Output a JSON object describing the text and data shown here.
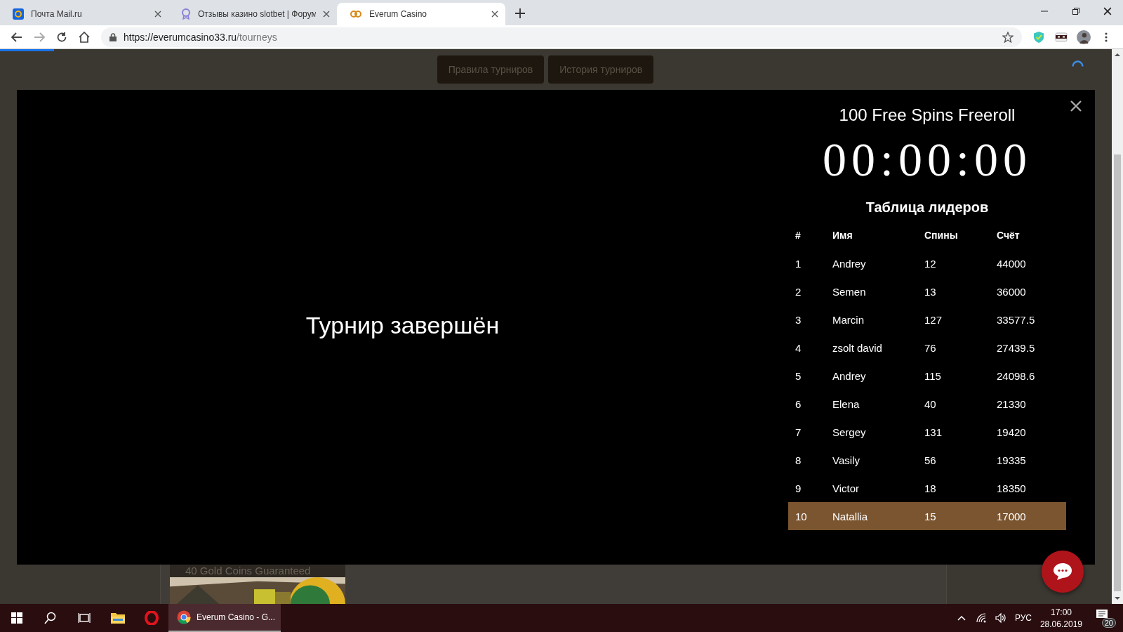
{
  "browser": {
    "tabs": [
      {
        "title": "Почта Mail.ru",
        "kind": "mail",
        "selected": false
      },
      {
        "title": "Отзывы казино slotbet | Форум",
        "kind": "forum",
        "selected": false
      },
      {
        "title": "Everum Casino",
        "kind": "casino",
        "selected": true
      }
    ],
    "url": {
      "host": "https://everumcasino33.ru",
      "path": "/tourneys"
    }
  },
  "page": {
    "buttons": [
      "Правила турниров",
      "История турниров"
    ],
    "modal": {
      "status": "Турнир завершён",
      "title": "100 Free Spins Freeroll",
      "timer": "00:00:00",
      "leaderboard": {
        "heading": "Таблица лидеров",
        "columns": [
          "#",
          "Имя",
          "Спины",
          "Счёт"
        ],
        "rows": [
          {
            "rank": "1",
            "name": "Andrey",
            "spins": "12",
            "score": "44000",
            "highlighted": false
          },
          {
            "rank": "2",
            "name": "Semen",
            "spins": "13",
            "score": "36000",
            "highlighted": false
          },
          {
            "rank": "3",
            "name": "Marcin",
            "spins": "127",
            "score": "33577.5",
            "highlighted": false
          },
          {
            "rank": "4",
            "name": "zsolt david",
            "spins": "76",
            "score": "27439.5",
            "highlighted": false
          },
          {
            "rank": "5",
            "name": "Andrey",
            "spins": "115",
            "score": "24098.6",
            "highlighted": false
          },
          {
            "rank": "6",
            "name": "Elena",
            "spins": "40",
            "score": "21330",
            "highlighted": false
          },
          {
            "rank": "7",
            "name": "Sergey",
            "spins": "131",
            "score": "19420",
            "highlighted": false
          },
          {
            "rank": "8",
            "name": "Vasily",
            "spins": "56",
            "score": "19335",
            "highlighted": false
          },
          {
            "rank": "9",
            "name": "Victor",
            "spins": "18",
            "score": "18350",
            "highlighted": false
          },
          {
            "rank": "10",
            "name": "Natallia",
            "spins": "15",
            "score": "17000",
            "highlighted": true
          }
        ]
      }
    },
    "card": {
      "title": "40 Gold Coins Guaranteed"
    }
  },
  "taskbar": {
    "apps": [
      {
        "kind": "start",
        "selected": false
      },
      {
        "kind": "search",
        "selected": false
      },
      {
        "kind": "taskview",
        "selected": false
      },
      {
        "kind": "explorer",
        "selected": false
      },
      {
        "kind": "opera",
        "selected": false
      },
      {
        "kind": "chrome",
        "label": "Everum Casino - G...",
        "selected": true
      }
    ],
    "tray": {
      "language": "РУС",
      "time": "17:00",
      "date": "28.06.2019",
      "notifications": "20"
    }
  }
}
